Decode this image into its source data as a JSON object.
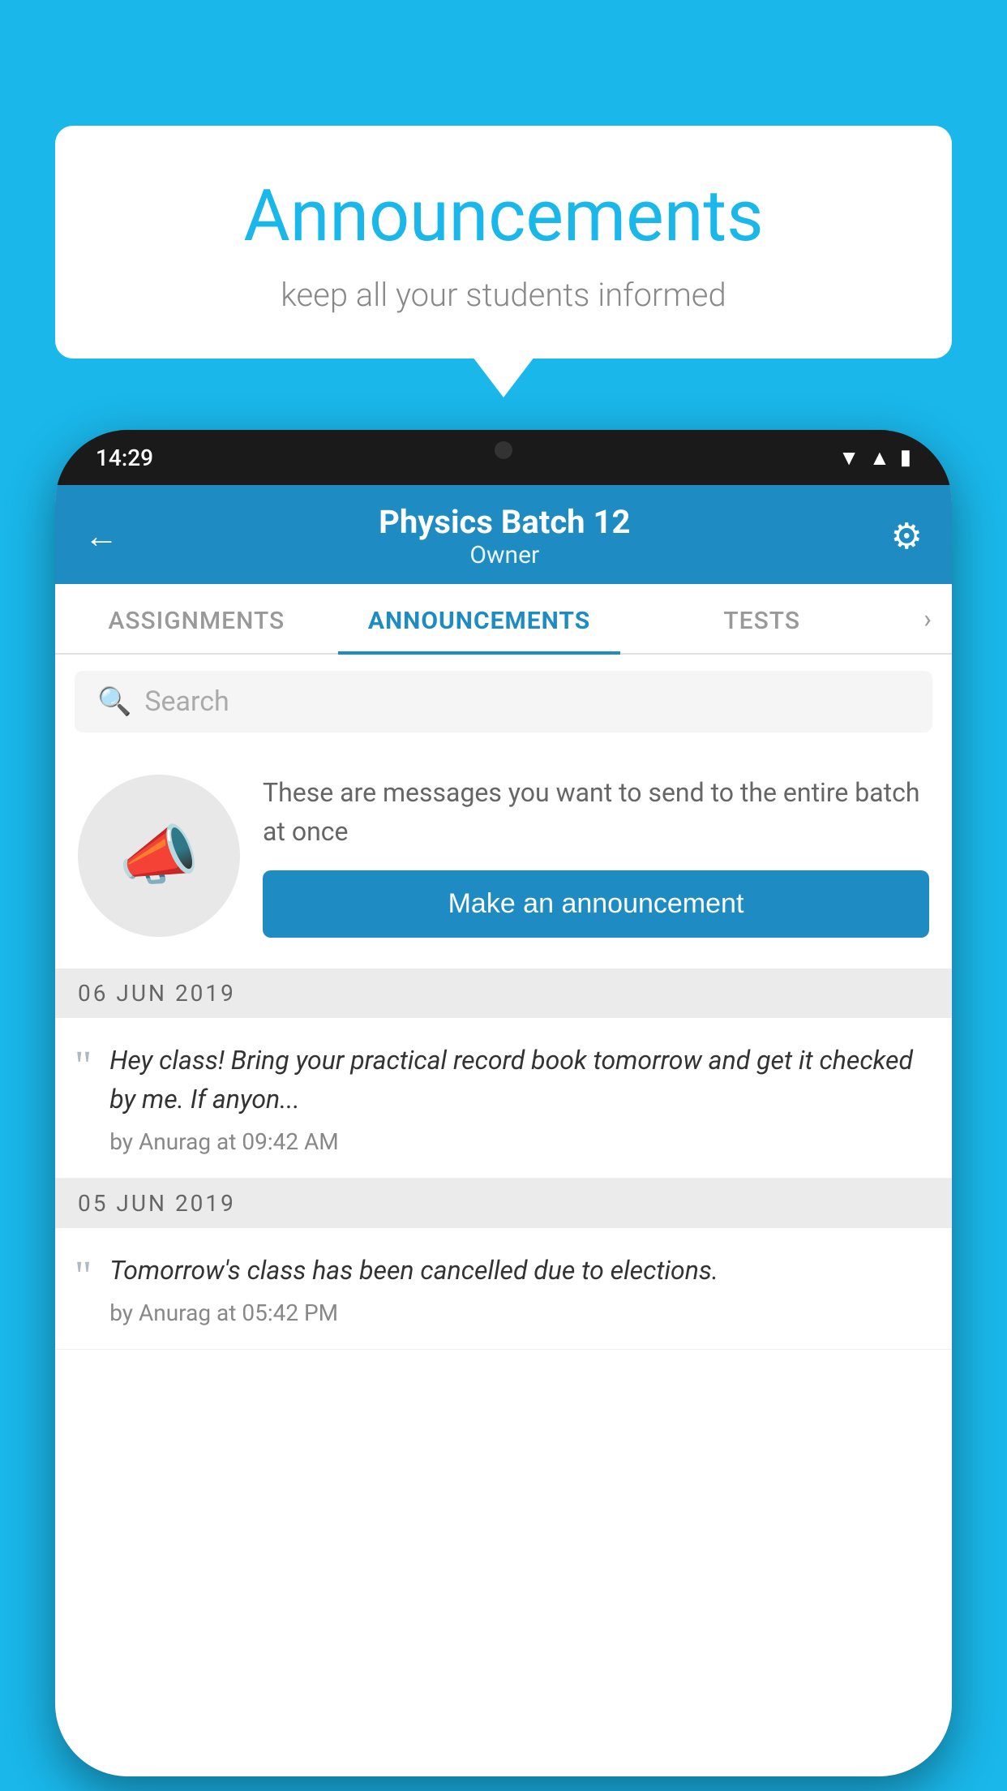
{
  "background_color": "#1ab7ea",
  "speech_bubble": {
    "title": "Announcements",
    "subtitle": "keep all your students informed"
  },
  "phone": {
    "status_bar": {
      "time": "14:29",
      "icons": [
        "wifi",
        "signal",
        "battery"
      ]
    },
    "header": {
      "title": "Physics Batch 12",
      "subtitle": "Owner",
      "back_label": "←",
      "gear_label": "⚙"
    },
    "tabs": [
      {
        "label": "ASSIGNMENTS",
        "active": false
      },
      {
        "label": "ANNOUNCEMENTS",
        "active": true
      },
      {
        "label": "TESTS",
        "active": false
      }
    ],
    "search": {
      "placeholder": "Search"
    },
    "promo": {
      "description": "These are messages you want to send to the entire batch at once",
      "button_label": "Make an announcement"
    },
    "announcements": [
      {
        "date": "06  JUN  2019",
        "text": "Hey class! Bring your practical record book tomorrow and get it checked by me. If anyon...",
        "meta": "by Anurag at 09:42 AM"
      },
      {
        "date": "05  JUN  2019",
        "text": "Tomorrow's class has been cancelled due to elections.",
        "meta": "by Anurag at 05:42 PM"
      }
    ]
  }
}
